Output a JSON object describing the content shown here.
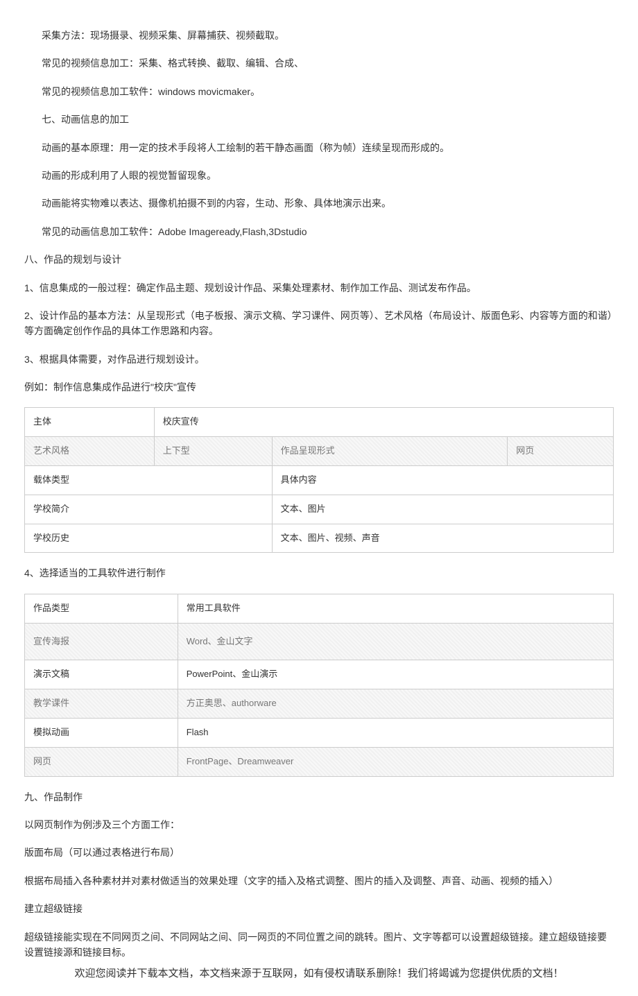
{
  "indented": {
    "p1": "采集方法：现场摄录、视频采集、屏幕捕获、视频截取。",
    "p2": "常见的视频信息加工：采集、格式转换、截取、编辑、合成、",
    "p3": "常见的视频信息加工软件：windows movicmaker。",
    "p4": "七、动画信息的加工",
    "p5": "动画的基本原理：用一定的技术手段将人工绘制的若干静态画面（称为帧）连续呈现而形成的。",
    "p6": "动画的形成利用了人眼的视觉暂留现象。",
    "p7": "动画能将实物难以表达、摄像机拍摄不到的内容，生动、形象、具体地演示出来。",
    "p8": "常见的动画信息加工软件：Adobe Imageready,Flash,3Dstudio"
  },
  "body": {
    "h8": "八、作品的规划与设计",
    "p9": "1、信息集成的一般过程：确定作品主题、规划设计作品、采集处理素材、制作加工作品、测试发布作品。",
    "p10": "2、设计作品的基本方法：从呈现形式（电子板报、演示文稿、学习课件、网页等）、艺术风格（布局设计、版面色彩、内容等方面的和谐）等方面确定创作作品的具体工作思路和内容。",
    "p11": "3、根据具体需要，对作品进行规划设计。",
    "p12": "例如：制作信息集成作品进行\"校庆\"宣传",
    "p13": "4、选择适当的工具软件进行制作",
    "h9": "九、作品制作",
    "p14": "以网页制作为例涉及三个方面工作：",
    "p15": "版面布局（可以通过表格进行布局）",
    "p16": "根据布局插入各种素材并对素材做适当的效果处理（文字的插入及格式调整、图片的插入及调整、声音、动画、视频的插入）",
    "p17": "建立超级链接",
    "p18": "超级链接能实现在不同网页之间、不同网站之间、同一网页的不同位置之间的跳转。图片、文字等都可以设置超级链接。建立超级链接要设置链接源和链接目标。"
  },
  "table1": {
    "r1c1": "主体",
    "r1c2": "校庆宣传",
    "r2c1": "艺术风格",
    "r2c2": "上下型",
    "r2c3": "作品呈现形式",
    "r2c4": "网页",
    "r3c1": "载体类型",
    "r3c2": "具体内容",
    "r4c1": "学校简介",
    "r4c2": "文本、图片",
    "r5c1": "学校历史",
    "r5c2": "文本、图片、视频、声音"
  },
  "table2": {
    "r1c1": "作品类型",
    "r1c2": "常用工具软件",
    "r2c1": "宣传海报",
    "r2c2": "Word、金山文字",
    "r3c1": "演示文稿",
    "r3c2": "PowerPoint、金山演示",
    "r4c1": "教学课件",
    "r4c2": "方正奥思、authorware",
    "r5c1": "模拟动画",
    "r5c2": "Flash",
    "r6c1": "网页",
    "r6c2": "FrontPage、Dreamweaver"
  },
  "footer": "欢迎您阅读并下载本文档，本文档来源于互联网，如有侵权请联系删除！我们将竭诚为您提供优质的文档！"
}
